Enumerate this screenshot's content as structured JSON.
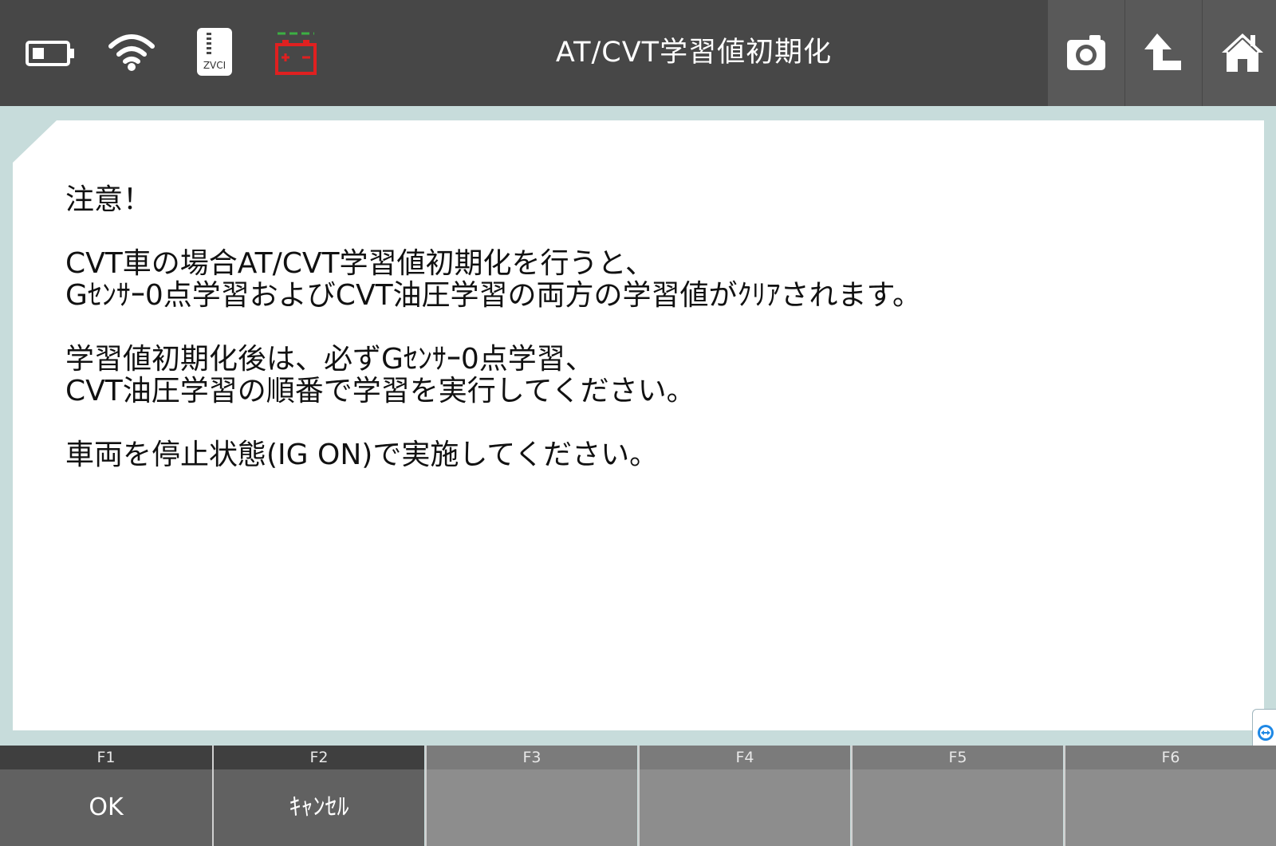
{
  "header": {
    "title": "AT/CVT学習値初期化",
    "status_icons": [
      "battery-icon",
      "wifi-icon",
      "zvci-icon",
      "car-battery-icon"
    ],
    "zvci_label": "ZVCI",
    "buttons": [
      "camera-icon",
      "back-icon",
      "home-icon"
    ]
  },
  "message": {
    "heading": "注意！",
    "lines": [
      "CVT車の場合AT/CVT学習値初期化を行うと、",
      "Gｾﾝｻｰ0点学習およびCVT油圧学習の両方の学習値がｸﾘｱされます。",
      "学習値初期化後は、必ずGｾﾝｻｰ0点学習、",
      "CVT油圧学習の順番で学習を実行してください。",
      "車両を停止状態(IG ON)で実施してください。"
    ]
  },
  "function_keys": [
    {
      "key": "F1",
      "text": "OK"
    },
    {
      "key": "F2",
      "text": "ｷｬﾝｾﾙ"
    },
    {
      "key": "F3",
      "text": ""
    },
    {
      "key": "F4",
      "text": ""
    },
    {
      "key": "F5",
      "text": ""
    },
    {
      "key": "F6",
      "text": ""
    }
  ],
  "colors": {
    "topbar": "#474747",
    "background": "#c7dcdb",
    "battery_warning": "#e02020",
    "battery_ok": "#3cb043"
  }
}
